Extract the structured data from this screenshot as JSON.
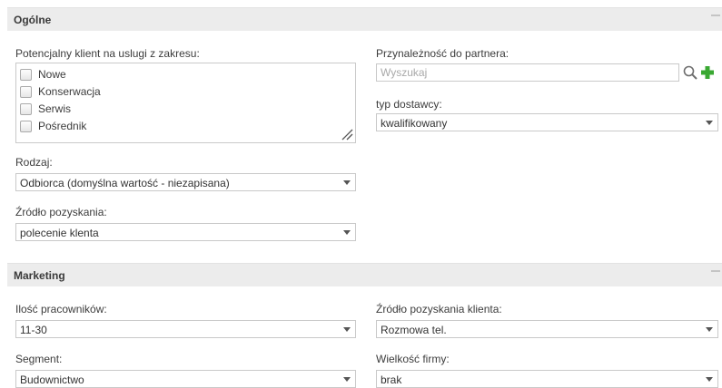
{
  "sections": {
    "general": {
      "title": "Ogólne"
    },
    "marketing": {
      "title": "Marketing"
    }
  },
  "general": {
    "services_label": "Potencjalny klient na uslugi z zakresu:",
    "services_options": [
      "Nowe",
      "Konserwacja",
      "Serwis",
      "Pośrednik"
    ],
    "partner_label": "Przynależność do partnera:",
    "partner_search_placeholder": "Wyszukaj",
    "partner_search_value": "",
    "supplier_type_label": "typ dostawcy:",
    "supplier_type_value": "kwalifikowany",
    "kind_label": "Rodzaj:",
    "kind_value": "Odbiorca (domyślna wartość - niezapisana)",
    "source_label": "Źródło pozyskania:",
    "source_value": "polecenie klenta"
  },
  "marketing": {
    "employees_label": "Ilość pracowników:",
    "employees_value": "11-30",
    "client_source_label": "Źródło pozyskania klienta:",
    "client_source_value": "Rozmowa tel.",
    "segment_label": "Segment:",
    "segment_value": "Budownictwo",
    "company_size_label": "Wielkość firmy:",
    "company_size_value": "brak"
  },
  "icons": {
    "search": "magnifier-icon",
    "add": "plus-icon",
    "collapse": "minus-icon",
    "resize": "resize-grip-icon"
  },
  "colors": {
    "section_bg": "#ececec",
    "add_icon_green": "#3aa832",
    "border": "#c9c9c9"
  }
}
